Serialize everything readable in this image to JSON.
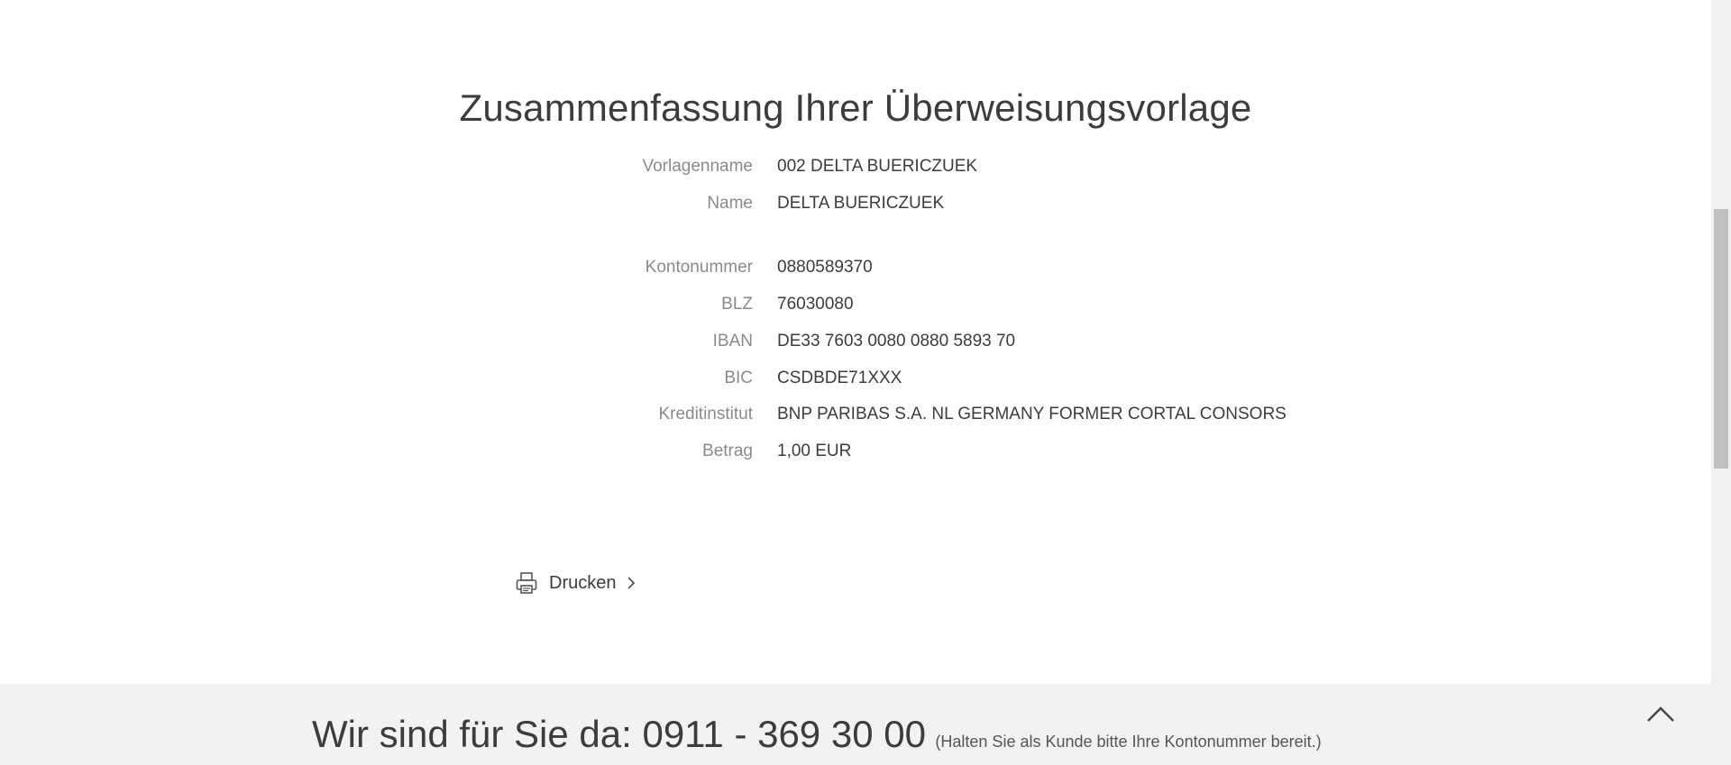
{
  "summary": {
    "title": "Zusammenfassung Ihrer Überweisungsvorlage",
    "rows": [
      {
        "label": "Vorlagenname",
        "value": "002 DELTA BUERICZUEK"
      },
      {
        "label": "Name",
        "value": "DELTA BUERICZUEK"
      },
      {
        "label": "Kontonummer",
        "value": "0880589370"
      },
      {
        "label": "BLZ",
        "value": "76030080"
      },
      {
        "label": "IBAN",
        "value": "DE33 7603 0080 0880 5893 70"
      },
      {
        "label": "BIC",
        "value": "CSDBDE71XXX"
      },
      {
        "label": "Kreditinstitut",
        "value": "BNP PARIBAS S.A. NL GERMANY FORMER CORTAL CONSORS"
      },
      {
        "label": "Betrag",
        "value": "1,00 EUR"
      }
    ]
  },
  "actions": {
    "print_label": "Drucken",
    "print_icon": "printer-icon",
    "chevron_icon": "chevron-right-icon"
  },
  "footer": {
    "headline": "Wir sind für Sie da: 0911 - 369 30 00",
    "note": "(Halten Sie als Kunde bitte Ihre Kontonummer bereit.)",
    "back_to_top_icon": "chevron-up-icon"
  },
  "colors": {
    "text": "#3c3c3c",
    "label": "#8a8a8a",
    "footer_bg": "#f2f2f2"
  }
}
